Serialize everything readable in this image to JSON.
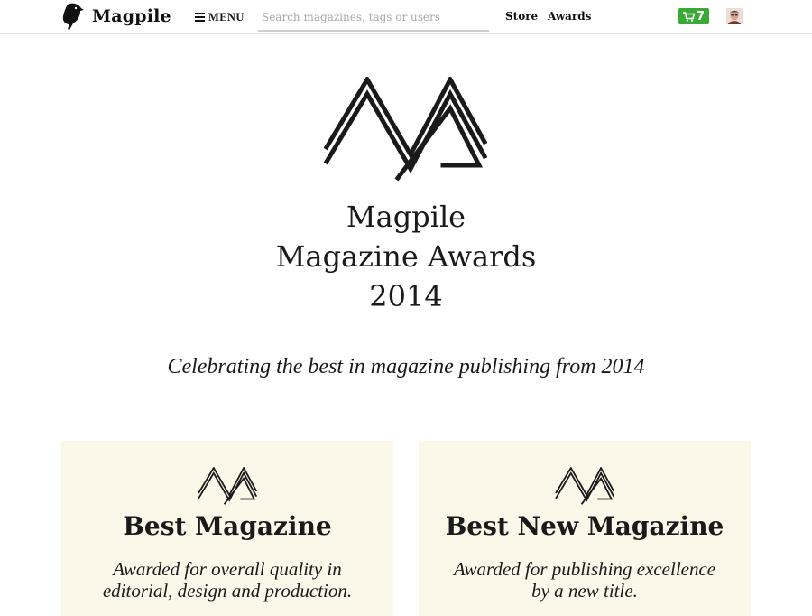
{
  "colors": {
    "accent_green": "#3aa935",
    "card_bg": "#fbf8ea",
    "text": "#1a1a1a"
  },
  "nav": {
    "brand": "Magpile",
    "brand_icon": "magpie-bird-icon",
    "menu_label": "MENU",
    "search_placeholder": "Search magazines, tags or users",
    "search_value": "",
    "links": {
      "store": "Store",
      "awards": "Awards"
    },
    "cart_count": "7",
    "cart_icon": "shopping-cart-icon",
    "avatar_icon": "user-avatar"
  },
  "hero": {
    "logo_icon": "ma-monogram-icon",
    "title_line1": "Magpile",
    "title_line2": "Magazine Awards",
    "title_line3": "2014",
    "tagline": "Celebrating the best in magazine publishing from 2014"
  },
  "cards": [
    {
      "title": "Best Magazine",
      "desc_line1": "Awarded for overall quality in",
      "desc_line2": "editorial, design and production."
    },
    {
      "title": "Best New Magazine",
      "desc_line1": "Awarded for publishing excellence",
      "desc_line2": "by a new title."
    }
  ]
}
